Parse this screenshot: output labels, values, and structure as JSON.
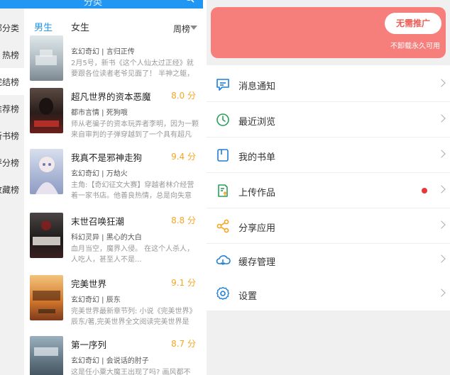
{
  "left_topbar": {
    "title": "分类"
  },
  "categories": [
    {
      "label": "全部分类"
    },
    {
      "label": "热榜"
    },
    {
      "label": "完结榜"
    },
    {
      "label": "推荐榜"
    },
    {
      "label": "新书榜"
    },
    {
      "label": "评分榜"
    },
    {
      "label": "收藏榜"
    }
  ],
  "tabs": [
    {
      "label": "男生"
    },
    {
      "label": "女生"
    }
  ],
  "rank_select": {
    "value": "周榜"
  },
  "books": [
    {
      "title": "",
      "score": "",
      "genre": "玄幻奇幻",
      "author": "言归正传",
      "desc": "2月5号，新书《这个人仙太过正经》就要跟各位读者老爷见面了！ 半神之躯，比肩...",
      "cover_color": "#c9d3d8"
    },
    {
      "title": "超凡世界的资本恶魔",
      "score": "8.0 分",
      "genre": "都市言情",
      "author": "死狗哦",
      "desc": "师从老骗子的资本玩弄者李明，因为一颗来自审判的子弹穿越到了一个具有超凡世...",
      "cover_color": "#3b2a26"
    },
    {
      "title": "我真不是邪神走狗",
      "score": "9.4 分",
      "genre": "玄幻奇幻",
      "author": "万劫火",
      "desc": "主角:【奇幻征文大赛】穿越者林介经营着一家书店。他善良热情，总是向失意潦...",
      "cover_color": "#b9c6e0"
    },
    {
      "title": "末世召唤狂潮",
      "score": "8.8 分",
      "genre": "科幻灵异",
      "author": "黑心的大白",
      "desc": "血月当空，魔界入侵。 在这个人杀人，人吃人，甚至人不是...",
      "cover_color": "#2e2b2b"
    },
    {
      "title": "完美世界",
      "score": "9.1 分",
      "genre": "玄幻奇幻",
      "author": "辰东",
      "desc": "完美世界最新章节列: 小说《完美世界》辰东/著,完美世界全文阅读完美世界是辰...",
      "cover_color": "#d98a3c"
    },
    {
      "title": "第一序列",
      "score": "8.7 分",
      "genre": "玄幻奇幻",
      "author": "会说话的肘子",
      "desc": "这是任小粟大魔王出现了吗? 画风都不带...",
      "cover_color": "#6a7f8c"
    }
  ],
  "promo": {
    "button_label": "无需推广",
    "subtitle": "不卸载永久可用",
    "color": "#f67f7c"
  },
  "menu": [
    {
      "label": "消息通知",
      "icon": "message-icon"
    },
    {
      "label": "最近浏览",
      "icon": "clock-icon"
    },
    {
      "label": "我的书单",
      "icon": "booklist-icon"
    },
    {
      "label": "上传作品",
      "icon": "upload-icon",
      "badge": true
    },
    {
      "label": "分享应用",
      "icon": "share-icon"
    },
    {
      "label": "缓存管理",
      "icon": "cloud-icon"
    }
  ],
  "settings": {
    "label": "设置",
    "icon": "gear-icon"
  },
  "colors": {
    "accent": "#2196f3",
    "score": "#f5a623",
    "menu_icon": "#1e7fd6",
    "badge": "#e53935"
  }
}
